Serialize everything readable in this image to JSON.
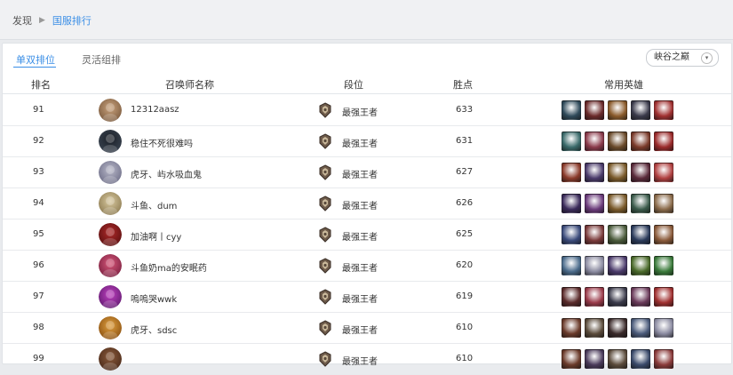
{
  "breadcrumb": {
    "root": "发现",
    "current": "国服排行"
  },
  "tabs": [
    {
      "label": "单双排位",
      "active": true
    },
    {
      "label": "灵活组排",
      "active": false
    }
  ],
  "map_select": {
    "value": "峡谷之巅"
  },
  "columns": {
    "rank": "排名",
    "name": "召唤师名称",
    "tier": "段位",
    "points": "胜点",
    "heroes": "常用英雄"
  },
  "accent_color": "#3a8ee6",
  "rows": [
    {
      "rank": "91",
      "name": "12312aasz",
      "tier": "最强王者",
      "points": "633",
      "avatar": [
        "#c9a27c",
        "#7a5a3e"
      ],
      "heroes": [
        "#2f4a5a",
        "#6b2a2a",
        "#8a5a2a",
        "#3a3a4a",
        "#a03030"
      ]
    },
    {
      "rank": "92",
      "name": "稳住不死很难吗",
      "tier": "最强王者",
      "points": "631",
      "avatar": [
        "#1a1f26",
        "#3b4552"
      ],
      "heroes": [
        "#3a6a6a",
        "#8a3a4a",
        "#6a4a2a",
        "#7a3a2a",
        "#9a2a2a"
      ]
    },
    {
      "rank": "93",
      "name": "虎牙、屿水吸血鬼",
      "tier": "最强王者",
      "points": "627",
      "avatar": [
        "#b8b8c8",
        "#6e6e88"
      ],
      "heroes": [
        "#8a3a2a",
        "#4a3a6a",
        "#7a5a2a",
        "#5a2a3a",
        "#b04040"
      ]
    },
    {
      "rank": "94",
      "name": "斗鱼、dum",
      "tier": "最强王者",
      "points": "626",
      "avatar": [
        "#d8c9a0",
        "#8c7a50"
      ],
      "heroes": [
        "#3a2a5a",
        "#6a3a7a",
        "#7a5a2a",
        "#3a5a4a",
        "#8a6a4a"
      ]
    },
    {
      "rank": "95",
      "name": "加油啊丨cyy",
      "tier": "最强王者",
      "points": "625",
      "avatar": [
        "#b02a2a",
        "#5a1010"
      ],
      "heroes": [
        "#3a4a7a",
        "#7a3a3a",
        "#4a5a3a",
        "#2a3a5a",
        "#8a5a3a"
      ]
    },
    {
      "rank": "96",
      "name": "斗鱼奶ma的安眠药",
      "tier": "最强王者",
      "points": "620",
      "avatar": [
        "#d8577a",
        "#7a2040"
      ],
      "heroes": [
        "#4a6a8a",
        "#8a8aa0",
        "#4a3a6a",
        "#4a6a2a",
        "#3a7a3a"
      ]
    },
    {
      "rank": "97",
      "name": "嗚嗚哭wwk",
      "tier": "最强王者",
      "points": "619",
      "avatar": [
        "#c040c0",
        "#601a70"
      ],
      "heroes": [
        "#5a2a2a",
        "#9a3a4a",
        "#3a3a4a",
        "#6a3a5a",
        "#a03030"
      ]
    },
    {
      "rank": "98",
      "name": "虎牙、sdsc",
      "tier": "最强王者",
      "points": "610",
      "avatar": [
        "#e0a040",
        "#8a5010"
      ],
      "heroes": [
        "#6a3a2a",
        "#5a4a3a",
        "#3a2a2a",
        "#4a5a7a",
        "#8a8aa0"
      ]
    },
    {
      "rank": "99",
      "name": "",
      "tier": "最强王者",
      "points": "610",
      "avatar": [
        "#8a5a3a",
        "#4a2a1a"
      ],
      "heroes": [
        "#6a3a2a",
        "#4a3a5a",
        "#5a4a3a",
        "#3a4a6a",
        "#8a3a3a"
      ]
    }
  ]
}
